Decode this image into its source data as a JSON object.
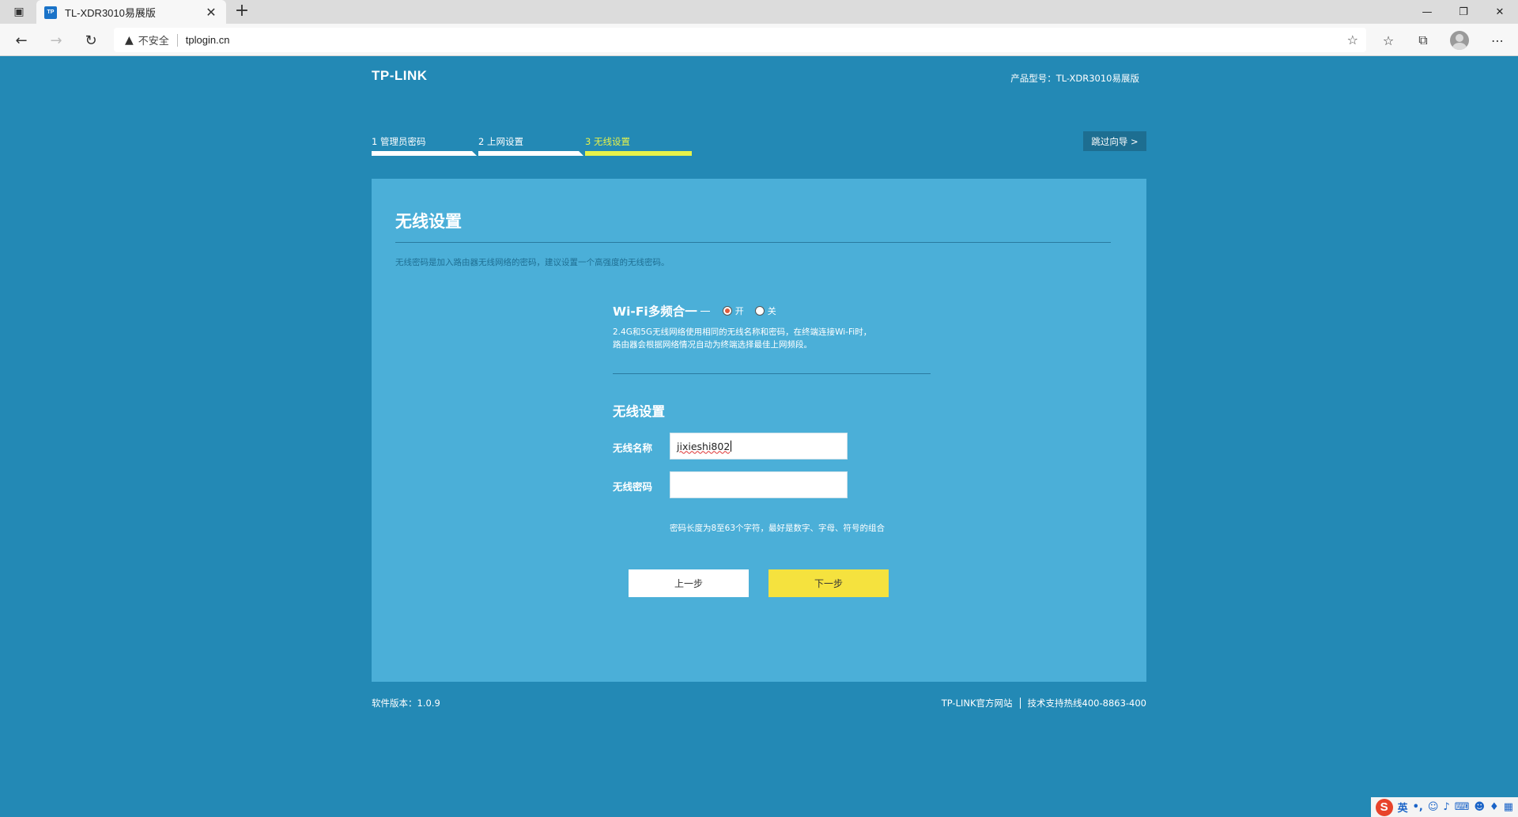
{
  "browser": {
    "tab_title": "TL-XDR3010易展版",
    "tab_favicon_text": "TP",
    "address_insecure": "不安全",
    "url": "tplogin.cn",
    "icons": [
      "sidebar-toggle-icon",
      "close-icon",
      "plus-icon",
      "back-icon",
      "forward-icon",
      "refresh-icon",
      "warning-icon",
      "add-favorite-icon",
      "favorites-icon",
      "collections-icon",
      "profile-icon",
      "more-icon"
    ]
  },
  "header": {
    "logo": "TP-LINK",
    "model": "产品型号：TL-XDR3010易展版"
  },
  "steps": [
    {
      "label": "1 管理员密码",
      "active": false
    },
    {
      "label": "2 上网设置",
      "active": false
    },
    {
      "label": "3 无线设置",
      "active": true
    }
  ],
  "skip_button": "跳过向导 >",
  "card": {
    "title": "无线设置",
    "description": "无线密码是加入路由器无线网络的密码，建议设置一个高强度的无线密码。",
    "multiband": {
      "label": "Wi-Fi多频合一",
      "on_label": "开",
      "off_label": "关",
      "selected": "on",
      "desc_line1": "2.4G和5G无线网络使用相同的无线名称和密码，在终端连接Wi-Fi时，",
      "desc_line2": "路由器会根据网络情况自动为终端选择最佳上网频段。"
    },
    "wireless": {
      "title": "无线设置",
      "ssid_label": "无线名称",
      "ssid_value": "jixieshi802",
      "password_label": "无线密码",
      "password_value": "",
      "password_hint": "密码长度为8至63个字符，最好是数字、字母、符号的组合"
    },
    "prev_button": "上一步",
    "next_button": "下一步"
  },
  "footer": {
    "version": "软件版本：1.0.9",
    "official_site": "TP-LINK官方网站",
    "hotline": "技术支持热线400-8863-400"
  },
  "ime": {
    "logo": "S",
    "mode": "英"
  },
  "colors": {
    "page_bg": "#2389b5",
    "card_bg": "#4bafd8",
    "active_step": "#e6f24a",
    "next_button": "#f5e23e"
  }
}
